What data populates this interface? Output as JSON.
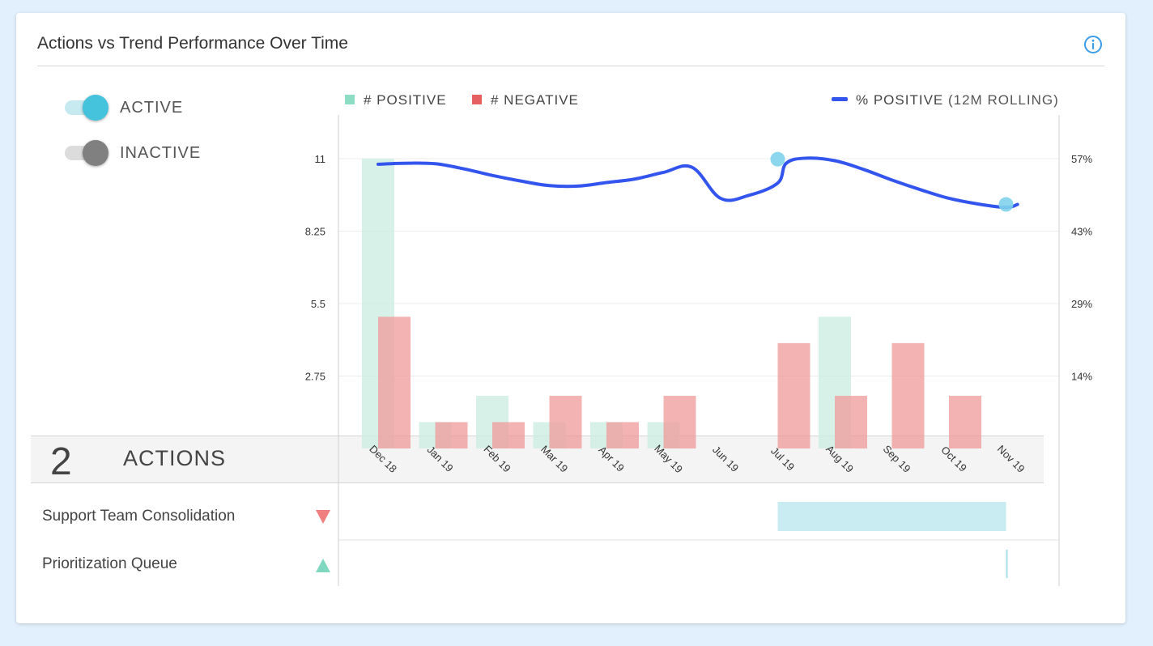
{
  "title": "Actions vs Trend Performance Over Time",
  "info_icon": "info-icon",
  "toggles": [
    {
      "label": "ACTIVE",
      "on": true,
      "color": "#45c3dc"
    },
    {
      "label": "INACTIVE",
      "on": false,
      "color": "#808080"
    }
  ],
  "legend": {
    "positive": "# POSITIVE",
    "negative": "# NEGATIVE",
    "rolling_main": "% POSITIVE",
    "rolling_suffix": "(12M ROLLING)"
  },
  "colors": {
    "positive": "#cdeee3",
    "negative": "#ef9999",
    "rolling_line": "#3355ee",
    "marker": "#7fd3ec",
    "action_bar": "#c8ecf1"
  },
  "chart_data": {
    "type": "bar",
    "categories": [
      "Dec 18",
      "Jan 19",
      "Feb 19",
      "Mar 19",
      "Apr 19",
      "May 19",
      "Jun 19",
      "Jul 19",
      "Aug 19",
      "Sep 19",
      "Oct 19",
      "Nov 19"
    ],
    "series": [
      {
        "name": "# POSITIVE",
        "type": "bar",
        "values": [
          11,
          1,
          2,
          1,
          1,
          1,
          0,
          0,
          5,
          0,
          0,
          0
        ]
      },
      {
        "name": "# NEGATIVE",
        "type": "bar",
        "values": [
          5,
          1,
          1,
          2,
          1,
          2,
          0,
          4,
          2,
          4,
          2,
          0
        ]
      },
      {
        "name": "% POSITIVE (12M ROLLING)",
        "type": "line",
        "axis": "right",
        "x": [
          0,
          0.5,
          1.0,
          1.5,
          2.0,
          2.5,
          3.0,
          3.5,
          4.0,
          4.5,
          5.0,
          5.5,
          6.0,
          6.5,
          7.0,
          7.15,
          7.5,
          8.0,
          8.5,
          9.0,
          9.5,
          10.0,
          10.5,
          11.0,
          11.2
        ],
        "values": [
          55.9,
          56.1,
          56.0,
          55.0,
          53.7,
          52.6,
          51.7,
          51.6,
          52.3,
          53.0,
          54.3,
          55.3,
          49.2,
          49.8,
          52.2,
          56.1,
          57.1,
          56.6,
          54.9,
          52.8,
          50.9,
          49.2,
          48.1,
          47.4,
          48.0
        ]
      }
    ],
    "markers": [
      {
        "x": 7.0,
        "value": 56.9
      },
      {
        "x": 11.0,
        "value": 48.0
      }
    ],
    "y_left": {
      "ticks": [
        "2.75",
        "5.5",
        "8.25",
        "11"
      ],
      "min": 0,
      "max": 11
    },
    "y_right": {
      "ticks": [
        "14%",
        "29%",
        "43%",
        "57%"
      ],
      "min": 0,
      "max": 57
    }
  },
  "actions": {
    "count": "2",
    "label": "ACTIONS",
    "items": [
      {
        "name": "Support Team Consolidation",
        "trend": "down",
        "start": 7.0,
        "end": 11.0
      },
      {
        "name": "Prioritization Queue",
        "trend": "up",
        "start": 11.0,
        "end": 11.0
      }
    ]
  }
}
